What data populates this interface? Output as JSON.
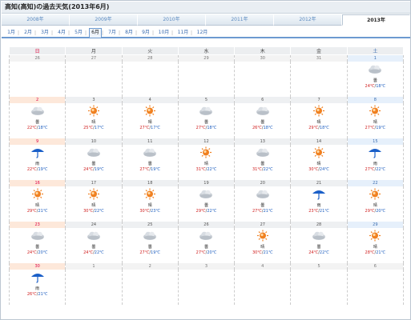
{
  "page": {
    "title": "高知(高知)の過去天気(2013年6月)"
  },
  "year_tabs": [
    "2008年",
    "2009年",
    "2010年",
    "2011年",
    "2012年",
    "2013年"
  ],
  "active_year_index": 5,
  "months": [
    "1月",
    "2月",
    "3月",
    "4月",
    "5月",
    "6月",
    "7月",
    "8月",
    "9月",
    "10月",
    "11月",
    "12月"
  ],
  "active_month_index": 5,
  "weekdays": [
    "日",
    "月",
    "火",
    "水",
    "木",
    "金",
    "土"
  ],
  "weeks": [
    [
      {
        "day": "26",
        "other": true
      },
      {
        "day": "27",
        "other": true
      },
      {
        "day": "28",
        "other": true
      },
      {
        "day": "29",
        "other": true
      },
      {
        "day": "30",
        "other": true
      },
      {
        "day": "31",
        "other": true
      },
      {
        "day": "1",
        "icon": "cloudy-icon",
        "label": "曇",
        "hi": "24℃",
        "lo": "18℃"
      }
    ],
    [
      {
        "day": "2",
        "icon": "cloudy-icon",
        "label": "曇",
        "hi": "22℃",
        "lo": "18℃"
      },
      {
        "day": "3",
        "icon": "sunny-icon",
        "label": "晴",
        "hi": "25℃",
        "lo": "17℃"
      },
      {
        "day": "4",
        "icon": "sunny-icon",
        "label": "晴",
        "hi": "27℃",
        "lo": "17℃"
      },
      {
        "day": "5",
        "icon": "cloudy-icon",
        "label": "曇",
        "hi": "27℃",
        "lo": "18℃"
      },
      {
        "day": "6",
        "icon": "cloudy-icon",
        "label": "曇",
        "hi": "26℃",
        "lo": "18℃"
      },
      {
        "day": "7",
        "icon": "sunny-icon",
        "label": "晴",
        "hi": "29℃",
        "lo": "18℃"
      },
      {
        "day": "8",
        "icon": "sunny-icon",
        "label": "晴",
        "hi": "27℃",
        "lo": "19℃"
      }
    ],
    [
      {
        "day": "9",
        "icon": "rain-icon",
        "label": "雨",
        "hi": "22℃",
        "lo": "19℃"
      },
      {
        "day": "10",
        "icon": "cloudy-icon",
        "label": "曇",
        "hi": "24℃",
        "lo": "19℃"
      },
      {
        "day": "11",
        "icon": "cloudy-icon",
        "label": "曇",
        "hi": "27℃",
        "lo": "19℃"
      },
      {
        "day": "12",
        "icon": "sunny-icon",
        "label": "晴",
        "hi": "31℃",
        "lo": "22℃"
      },
      {
        "day": "13",
        "icon": "cloudy-icon",
        "label": "曇",
        "hi": "31℃",
        "lo": "22℃"
      },
      {
        "day": "14",
        "icon": "sunny-icon",
        "label": "晴",
        "hi": "30℃",
        "lo": "24℃"
      },
      {
        "day": "15",
        "icon": "rain-icon",
        "label": "雨",
        "hi": "27℃",
        "lo": "22℃"
      }
    ],
    [
      {
        "day": "16",
        "icon": "sunny-icon",
        "label": "晴",
        "hi": "29℃",
        "lo": "21℃"
      },
      {
        "day": "17",
        "icon": "sunny-icon",
        "label": "晴",
        "hi": "30℃",
        "lo": "22℃"
      },
      {
        "day": "18",
        "icon": "sunny-icon",
        "label": "晴",
        "hi": "30℃",
        "lo": "23℃"
      },
      {
        "day": "19",
        "icon": "cloudy-icon",
        "label": "曇",
        "hi": "29℃",
        "lo": "22℃"
      },
      {
        "day": "20",
        "icon": "cloudy-icon",
        "label": "曇",
        "hi": "27℃",
        "lo": "21℃"
      },
      {
        "day": "21",
        "icon": "rain-icon",
        "label": "雨",
        "hi": "23℃",
        "lo": "21℃"
      },
      {
        "day": "22",
        "icon": "sunny-icon",
        "label": "晴",
        "hi": "29℃",
        "lo": "20℃"
      }
    ],
    [
      {
        "day": "23",
        "icon": "cloudy-icon",
        "label": "曇",
        "hi": "24℃",
        "lo": "20℃"
      },
      {
        "day": "24",
        "icon": "cloudy-icon",
        "label": "曇",
        "hi": "24℃",
        "lo": "22℃"
      },
      {
        "day": "25",
        "icon": "cloudy-icon",
        "label": "曇",
        "hi": "27℃",
        "lo": "19℃"
      },
      {
        "day": "26",
        "icon": "cloudy-icon",
        "label": "曇",
        "hi": "27℃",
        "lo": "20℃"
      },
      {
        "day": "27",
        "icon": "sunny-icon",
        "label": "晴",
        "hi": "30℃",
        "lo": "21℃"
      },
      {
        "day": "28",
        "icon": "cloudy-icon",
        "label": "曇",
        "hi": "24℃",
        "lo": "22℃"
      },
      {
        "day": "29",
        "icon": "sunny-icon",
        "label": "晴",
        "hi": "28℃",
        "lo": "21℃"
      }
    ],
    [
      {
        "day": "30",
        "icon": "rain-icon",
        "label": "雨",
        "hi": "26℃",
        "lo": "21℃"
      },
      {
        "day": "1",
        "other": true
      },
      {
        "day": "2",
        "other": true
      },
      {
        "day": "3",
        "other": true
      },
      {
        "day": "4",
        "other": true
      },
      {
        "day": "5",
        "other": true
      },
      {
        "day": "6",
        "other": true
      }
    ]
  ],
  "colors": {
    "high_temp": "#d02020",
    "low_temp": "#2060c0",
    "sun": "#f08020",
    "rain": "#1a5fc8",
    "cloud": "#c9cfd6"
  }
}
